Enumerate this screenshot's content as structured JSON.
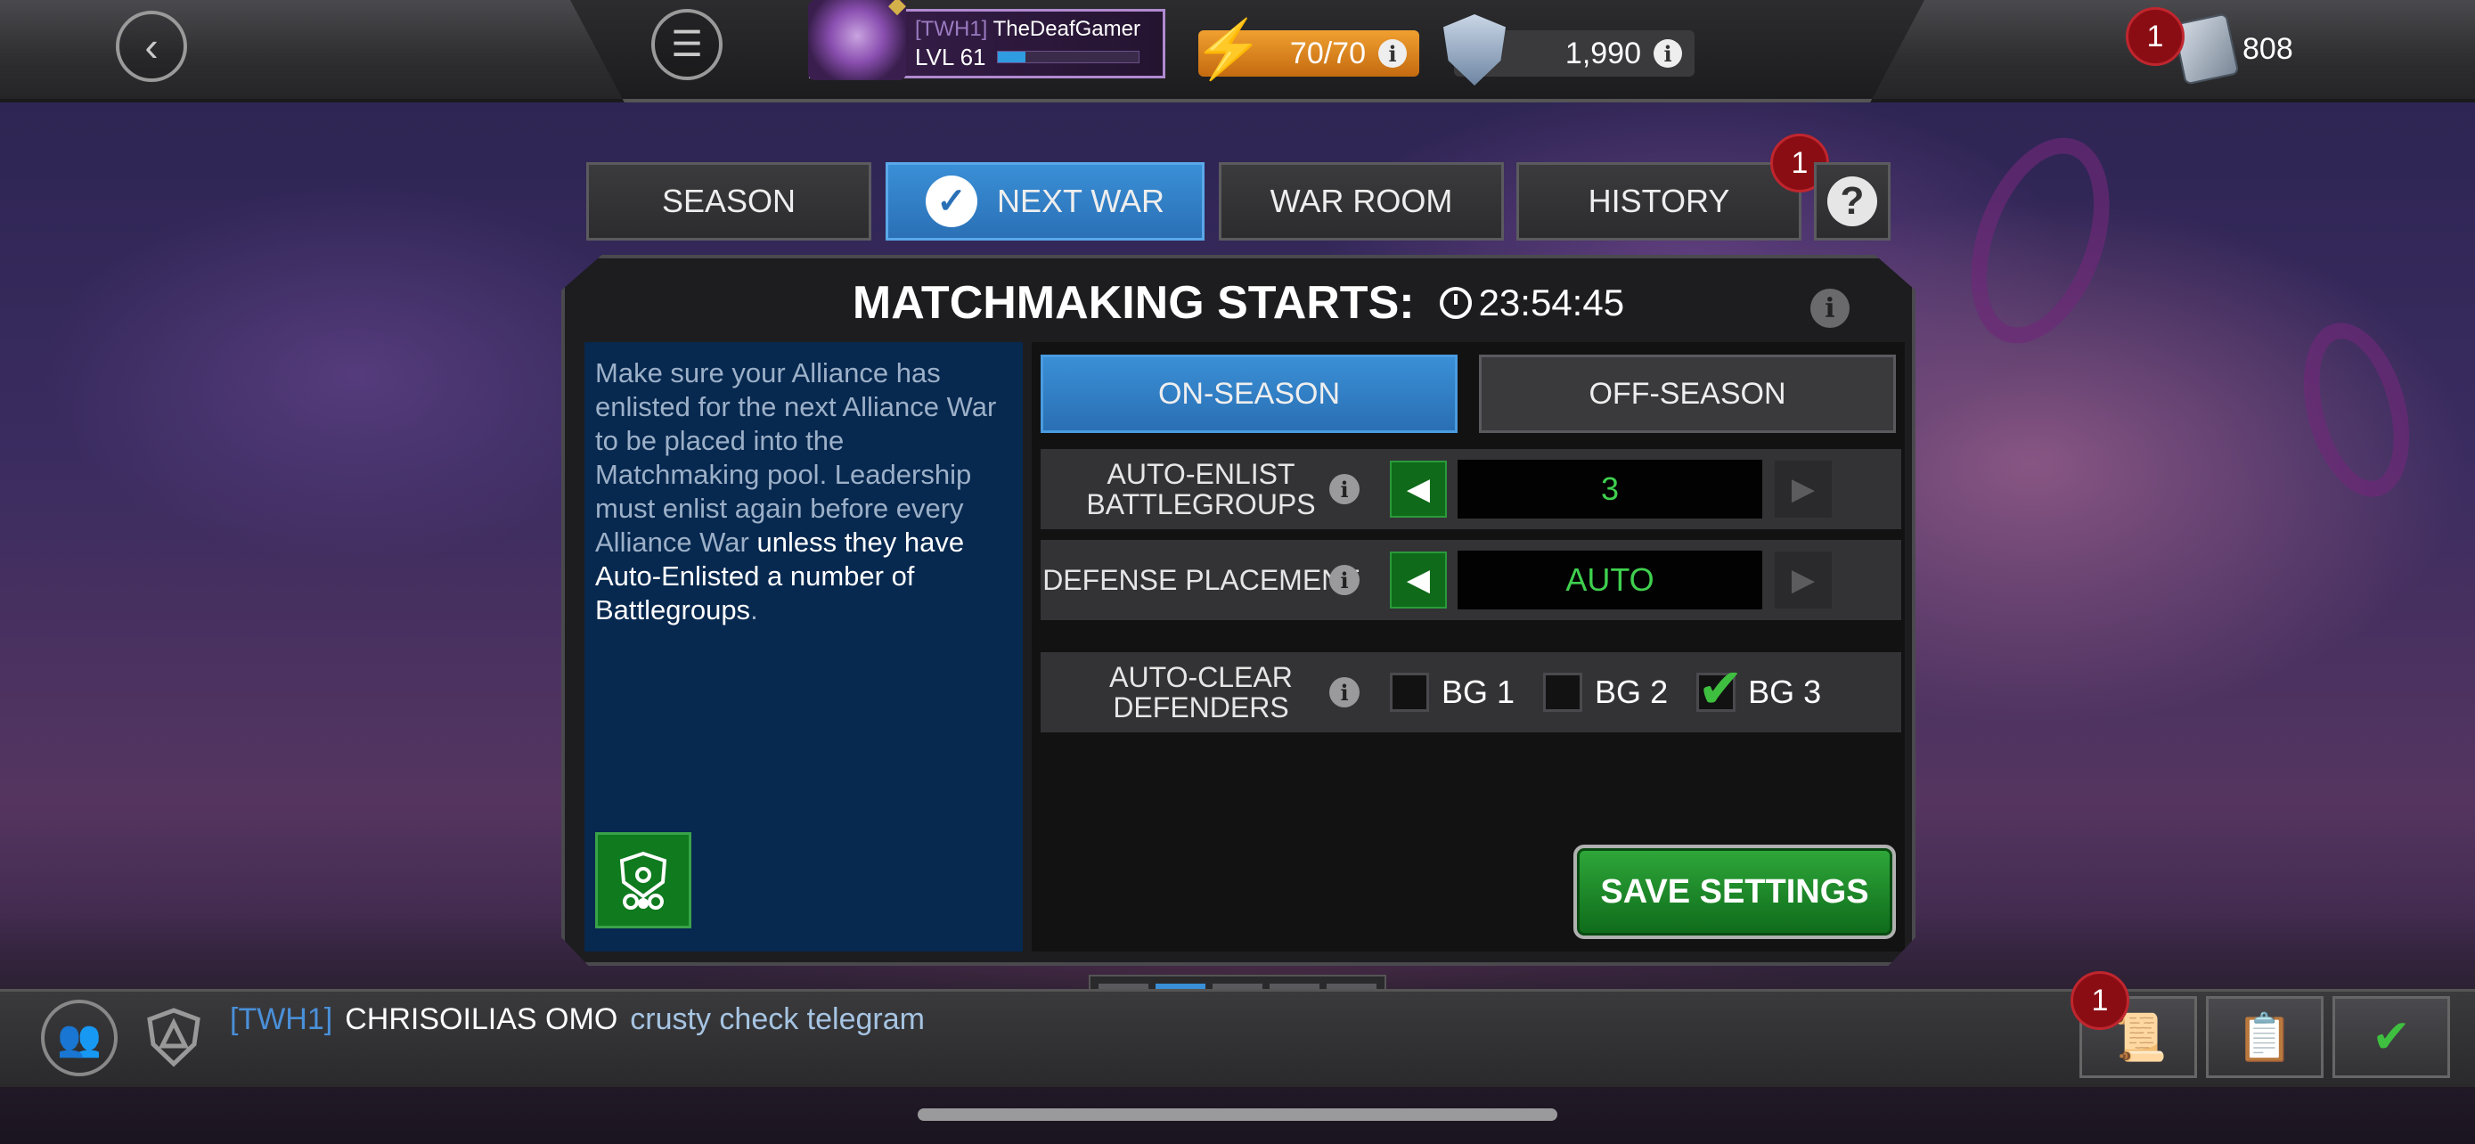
{
  "header": {
    "back_icon": "chevron-left-icon",
    "menu_icon": "hamburger-menu-icon",
    "player": {
      "tag": "[TWH1]",
      "name": "TheDeafGamer",
      "level": "LVL 61",
      "xp_fraction": 0.2
    },
    "energy": "70/70",
    "shields": "1,990",
    "currency_badge": "1",
    "currency": "808"
  },
  "tabs": [
    {
      "label": "SEASON",
      "active": false
    },
    {
      "label": "NEXT WAR",
      "active": true
    },
    {
      "label": "WAR ROOM",
      "active": false
    },
    {
      "label": "HISTORY",
      "active": false,
      "badge": "1"
    }
  ],
  "help_label": "?",
  "panel": {
    "title": "MATCHMAKING STARTS:",
    "timer": "23:54:45",
    "description_dim": "Make sure your Alliance has enlisted for the next Alliance War to be placed into the Matchmaking pool. Leadership must enlist again before every Alliance War",
    "description_bright": " unless they have Auto-Enlisted a number of Battlegroups",
    "description_end": ".",
    "season_toggle": {
      "on": "ON-SEASON",
      "off": "OFF-SEASON",
      "selected": "ON-SEASON"
    },
    "auto_enlist": {
      "label": "AUTO-ENLIST BATTLEGROUPS",
      "value": "3"
    },
    "defense_placement": {
      "label": "DEFENSE PLACEMENT",
      "value": "AUTO"
    },
    "auto_clear": {
      "label": "AUTO-CLEAR DEFENDERS",
      "options": [
        {
          "label": "BG 1",
          "checked": false
        },
        {
          "label": "BG 2",
          "checked": false
        },
        {
          "label": "BG 3",
          "checked": true
        }
      ]
    },
    "save_label": "SAVE SETTINGS"
  },
  "pager": {
    "pages": 5,
    "current": 2
  },
  "chat": {
    "tag": "[TWH1]",
    "user": "CHRISOILIAS OMO",
    "message": "crusty check telegram"
  },
  "bottom_badge": "1",
  "colors": {
    "accent_blue": "#2a70b6",
    "value_green": "#3fd04f",
    "badge_red": "#8b0d14",
    "energy_orange": "#e08a20"
  }
}
